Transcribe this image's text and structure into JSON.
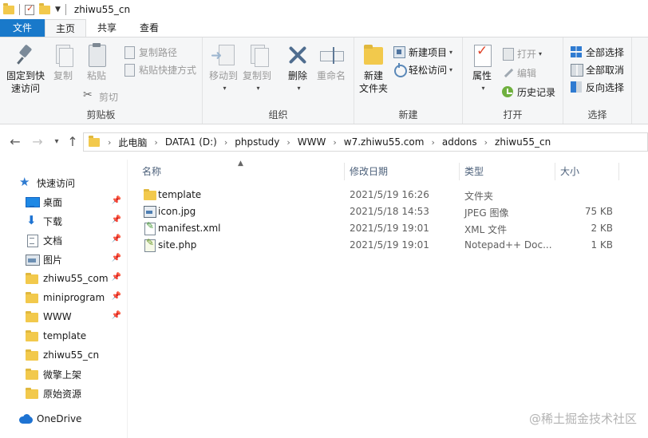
{
  "window": {
    "title": "zhiwu55_cn"
  },
  "ribbon_tabs": [
    "文件",
    "主页",
    "共享",
    "查看"
  ],
  "ribbon": {
    "clipboard": {
      "label": "剪贴板",
      "pin_quick_access": "固定到快\n速访问",
      "copy": "复制",
      "paste": "粘贴",
      "copy_path": "复制路径",
      "paste_shortcut": "粘贴快捷方式",
      "cut": "剪切"
    },
    "organize": {
      "label": "组织",
      "move_to": "移动到",
      "copy_to": "复制到",
      "delete": "删除",
      "rename": "重命名"
    },
    "new": {
      "label": "新建",
      "new_folder": "新建\n文件夹",
      "new_item": "新建项目",
      "easy_access": "轻松访问"
    },
    "open": {
      "label": "打开",
      "properties": "属性",
      "open": "打开",
      "edit": "编辑",
      "history": "历史记录"
    },
    "select": {
      "label": "选择",
      "select_all": "全部选择",
      "select_none": "全部取消",
      "invert_selection": "反向选择"
    }
  },
  "address": {
    "crumbs": [
      "此电脑",
      "DATA1 (D:)",
      "phpstudy",
      "WWW",
      "w7.zhiwu55.com",
      "addons",
      "zhiwu55_cn"
    ]
  },
  "nav_pane": {
    "quick_access": "快速访问",
    "items": [
      {
        "label": "桌面",
        "icon": "desktop-icon",
        "pinned": true
      },
      {
        "label": "下载",
        "icon": "download-icon",
        "pinned": true
      },
      {
        "label": "文档",
        "icon": "documents-icon",
        "pinned": true
      },
      {
        "label": "图片",
        "icon": "pictures-icon",
        "pinned": true
      },
      {
        "label": "zhiwu55_com",
        "icon": "folder-icon",
        "pinned": true
      },
      {
        "label": "miniprogram",
        "icon": "folder-icon",
        "pinned": true
      },
      {
        "label": "WWW",
        "icon": "folder-icon",
        "pinned": true
      },
      {
        "label": "template",
        "icon": "folder-icon",
        "pinned": false
      },
      {
        "label": "zhiwu55_cn",
        "icon": "folder-icon",
        "pinned": false
      },
      {
        "label": "微擎上架",
        "icon": "folder-icon",
        "pinned": false
      },
      {
        "label": "原始资源",
        "icon": "folder-icon",
        "pinned": false
      }
    ],
    "onedrive": "OneDrive"
  },
  "file_list": {
    "columns": [
      "名称",
      "修改日期",
      "类型",
      "大小"
    ],
    "rows": [
      {
        "name": "template",
        "modified": "2021/5/19 16:26",
        "type": "文件夹",
        "size": "",
        "icon": "folder-icon"
      },
      {
        "name": "icon.jpg",
        "modified": "2021/5/18 14:53",
        "type": "JPEG 图像",
        "size": "75 KB",
        "icon": "image-file-icon"
      },
      {
        "name": "manifest.xml",
        "modified": "2021/5/19 19:01",
        "type": "XML 文件",
        "size": "2 KB",
        "icon": "xml-file-icon"
      },
      {
        "name": "site.php",
        "modified": "2021/5/19 19:01",
        "type": "Notepad++ Doc...",
        "size": "1 KB",
        "icon": "php-file-icon"
      }
    ]
  },
  "watermark": "@稀土掘金技术社区",
  "colors": {
    "file_tab": "#1979ca",
    "folder": "#f2c94c",
    "column_header_text": "#4c607a"
  }
}
